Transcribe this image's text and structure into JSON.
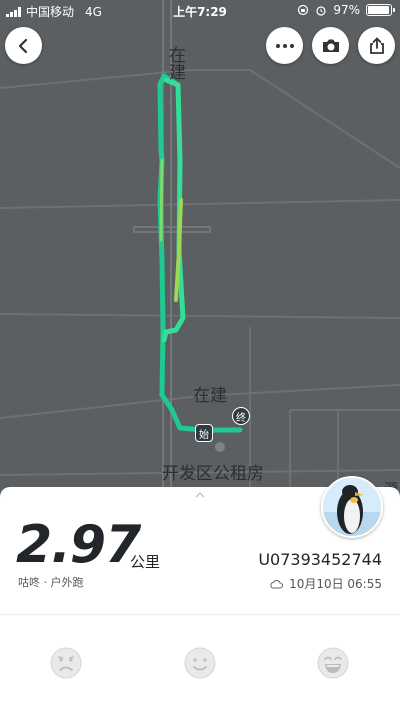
{
  "status_bar": {
    "carrier": "中国移动",
    "network": "4G",
    "time": "上午7:29",
    "battery": "97%"
  },
  "map": {
    "labels": {
      "road_top": "在建",
      "road_mid": "在建",
      "place": "开发区公租房",
      "edge": "源"
    },
    "markers": {
      "start": "始",
      "end": "终"
    },
    "route_color": "#22d39a"
  },
  "toolbar": {
    "back_icon": "back-arrow-icon",
    "more_icon": "more-icon",
    "camera_icon": "camera-icon",
    "share_icon": "share-icon"
  },
  "summary": {
    "distance": "2.97",
    "unit": "公里",
    "user": "咕咚 · 户外跑",
    "run_id": "U07393452744",
    "date": "10月10日 06:55"
  },
  "mood": [
    "sad-face-icon",
    "smile-face-icon",
    "laugh-face-icon"
  ]
}
